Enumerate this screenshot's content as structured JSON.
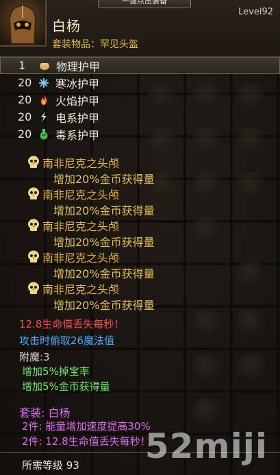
{
  "header": {
    "top_tab": "一键点出装备",
    "item_name": "白杨",
    "level": "Level92",
    "set_item": "套装物品：罕见头盔"
  },
  "stats": [
    {
      "value": "1",
      "name": "物理护甲",
      "icon": "fist-icon",
      "selected": true
    },
    {
      "value": "20",
      "name": "寒冰护甲",
      "icon": "snowflake-icon"
    },
    {
      "value": "20",
      "name": "火焰护甲",
      "icon": "flame-icon"
    },
    {
      "value": "20",
      "name": "电系护甲",
      "icon": "lightning-icon"
    },
    {
      "value": "20",
      "name": "毒系护甲",
      "icon": "poison-flask-icon"
    }
  ],
  "gems": [
    {
      "name": "南非尼克之头颅",
      "effect": "增加20%金币获得量"
    },
    {
      "name": "南非尼克之头颅",
      "effect": "增加20%金币获得量"
    },
    {
      "name": "南非尼克之头颅",
      "effect": "增加20%金币获得量"
    },
    {
      "name": "南非尼克之头颅",
      "effect": "增加20%金币获得量"
    },
    {
      "name": "南非尼克之头颅",
      "effect": "增加20%金币获得量"
    }
  ],
  "affixes": {
    "life_loss": "12.8生命值丢失每秒！",
    "mana_steal": "攻击时偷取26魔法值",
    "enchant": "附魔:3",
    "drop_rate": "增加5%掉宝率",
    "gold": "增加5%金币获得量"
  },
  "set": {
    "title": "套装: 白杨",
    "bonus1": "2件: 能量增加速度提高30%",
    "bonus2": "2件: 12.8生命值丢失每秒！"
  },
  "requirement": "所需等级 93",
  "watermark": "52miji",
  "colors": {
    "gold": "#e7b64a",
    "red": "#ff4a4a",
    "blue": "#4aa8ff",
    "green": "#6ee86e",
    "purple": "#d96cf0"
  }
}
